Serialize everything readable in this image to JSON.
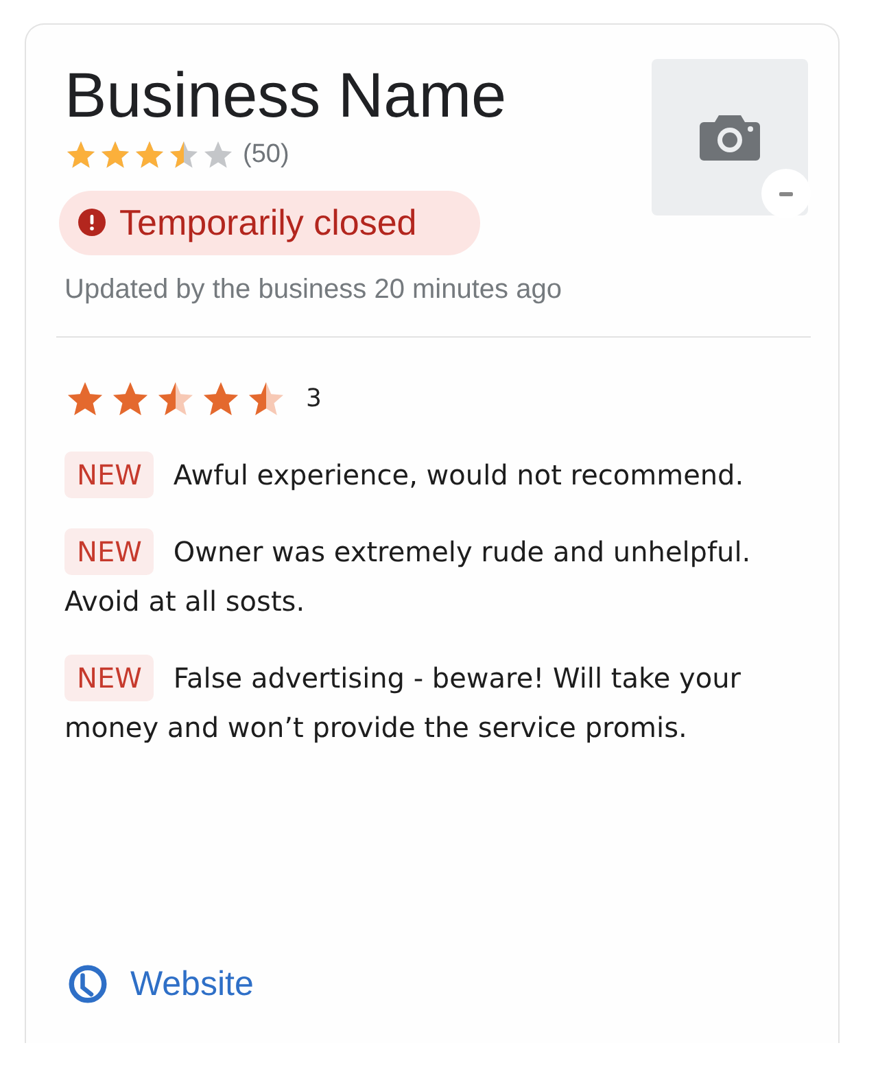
{
  "business": {
    "name": "Business Name",
    "stars": 3.5,
    "review_count": "(50)",
    "status": "Temporarily closed",
    "updated": "Updated by the business 20 minutes ago"
  },
  "review_rating": {
    "stars": [
      {
        "kind": "full"
      },
      {
        "kind": "full"
      },
      {
        "kind": "half"
      },
      {
        "kind": "full"
      },
      {
        "kind": "half"
      }
    ],
    "count": "3"
  },
  "reviews": [
    {
      "badge": "NEW",
      "lines": [
        "Awful experience, would not recommend."
      ]
    },
    {
      "badge": "NEW",
      "lines": [
        "Owner was extremely rude and unhelpful.",
        "Avoid at all sosts."
      ]
    },
    {
      "badge": "NEW",
      "lines": [
        "False advertising - beware! Will take your",
        "money and won’t provide the service promis."
      ]
    }
  ],
  "link": {
    "label": "Website"
  }
}
